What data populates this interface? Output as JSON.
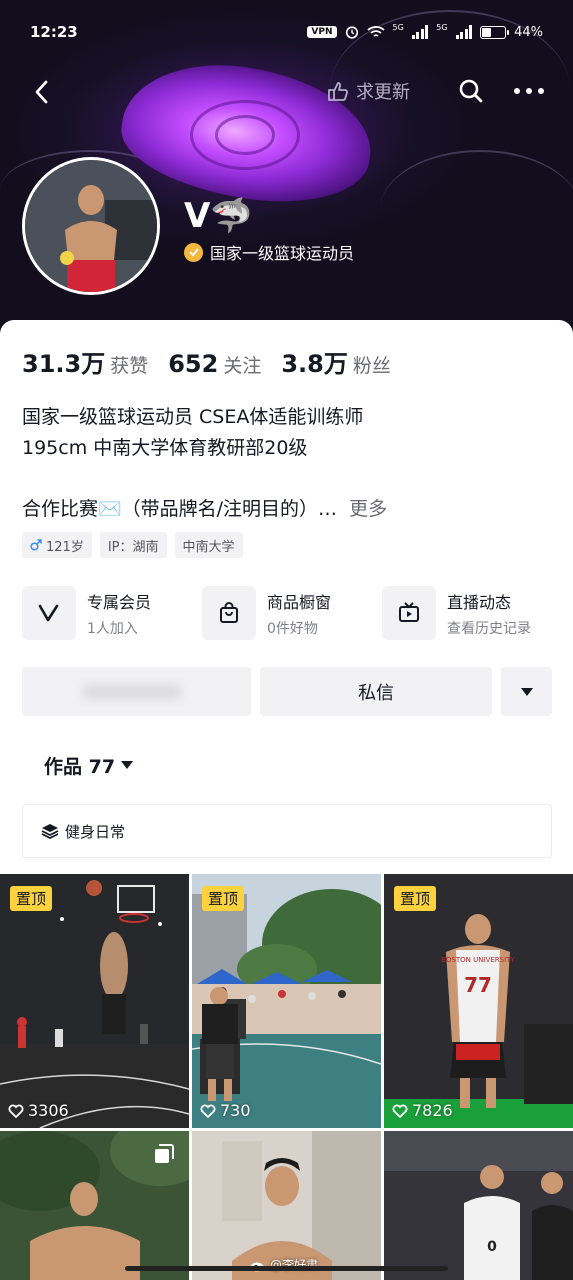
{
  "status_bar": {
    "time": "12:23",
    "vpn": "VPN",
    "net1": "5G",
    "net2": "5G",
    "battery_pct": "44%"
  },
  "nav": {
    "update_label": "求更新"
  },
  "profile": {
    "nickname": "V🦈",
    "verify_text": "国家一级篮球运动员",
    "colors": {
      "verify_badge": "#f5b73d",
      "banner_bg": "#171127",
      "eye_accent": "#c34dff"
    }
  },
  "stats": [
    {
      "num": "31.3万",
      "label": "获赞"
    },
    {
      "num": "652",
      "label": "关注"
    },
    {
      "num": "3.8万",
      "label": "粉丝"
    }
  ],
  "bio": {
    "line1": "国家一级篮球运动员 CSEA体适能训练师",
    "line2": "195cm  中南大学体育教研部20级"
  },
  "collab": {
    "text": "合作比赛✉️（带品牌名/注明目的）…",
    "more": "更多"
  },
  "tags": {
    "age": "121岁",
    "ip": "IP：湖南",
    "school": "中南大学"
  },
  "features": [
    {
      "icon": "v-logo-icon",
      "title": "专属会员",
      "sub": "1人加入"
    },
    {
      "icon": "shopping-bag-icon",
      "title": "商品橱窗",
      "sub": "0件好物"
    },
    {
      "icon": "tv-live-icon",
      "title": "直播动态",
      "sub": "查看历史记录"
    }
  ],
  "actions": {
    "message": "私信"
  },
  "works": {
    "tab_label": "作品 77",
    "collection": "健身日常"
  },
  "videos": [
    {
      "pinned": "置顶",
      "likes": "3306"
    },
    {
      "pinned": "置顶",
      "likes": "730"
    },
    {
      "pinned": "置顶",
      "likes": "7826"
    },
    {
      "pinned": "",
      "likes": ""
    },
    {
      "pinned": "",
      "likes": ""
    },
    {
      "pinned": "",
      "likes": ""
    }
  ],
  "jersey": {
    "t3_text": "BOSTON UNIVERSITY",
    "t3_num": "77",
    "t6_num": "0"
  },
  "watermark": "@李好肃"
}
